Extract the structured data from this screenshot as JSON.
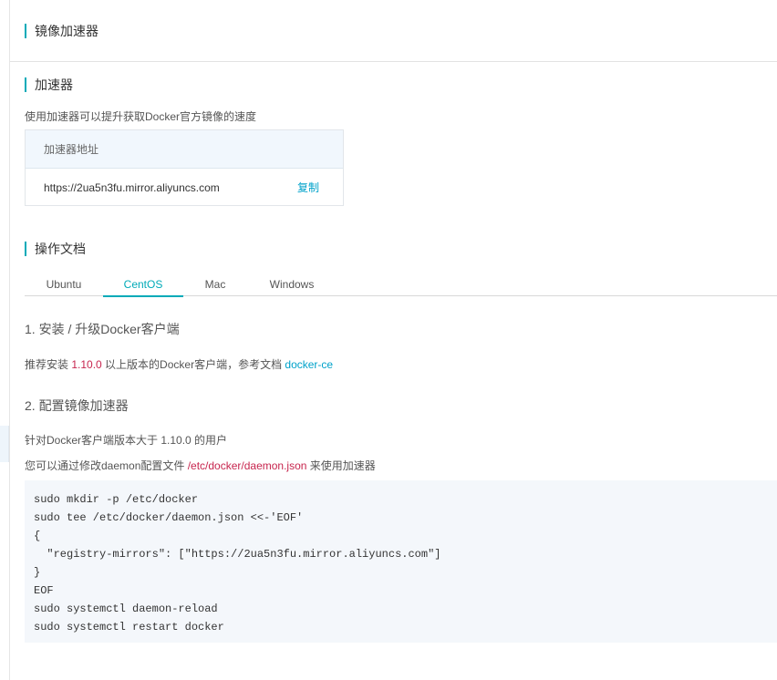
{
  "page": {
    "title": "镜像加速器"
  },
  "accelerator": {
    "title": "加速器",
    "description": "使用加速器可以提升获取Docker官方镜像的速度",
    "table_header": "加速器地址",
    "url": "https://2ua5n3fu.mirror.aliyuncs.com",
    "copy_label": "复制"
  },
  "docs": {
    "title": "操作文档",
    "tabs": [
      {
        "label": "Ubuntu",
        "active": false
      },
      {
        "label": "CentOS",
        "active": true
      },
      {
        "label": "Mac",
        "active": false
      },
      {
        "label": "Windows",
        "active": false
      }
    ],
    "step1": {
      "title": "1. 安装 / 升级Docker客户端",
      "text_before": "推荐安装 ",
      "version": "1.10.0",
      "text_after": " 以上版本的Docker客户端，参考文档 ",
      "link": "docker-ce"
    },
    "step2": {
      "title": "2. 配置镜像加速器",
      "line1": "针对Docker客户端版本大于 1.10.0 的用户",
      "line2_before": "您可以通过修改daemon配置文件 ",
      "config_path": "/etc/docker/daemon.json",
      "line2_after": " 来使用加速器"
    },
    "code_lines": [
      "sudo mkdir -p /etc/docker",
      "sudo tee /etc/docker/daemon.json <<-'EOF'",
      "{",
      "  \"registry-mirrors\": [\"https://2ua5n3fu.mirror.aliyuncs.com\"]",
      "}",
      "EOF",
      "sudo systemctl daemon-reload",
      "sudo systemctl restart docker"
    ]
  },
  "colors": {
    "accent": "#00aab8",
    "link": "#00a2ca",
    "highlight": "#c7254e",
    "code_bg": "#f4f7fb"
  }
}
